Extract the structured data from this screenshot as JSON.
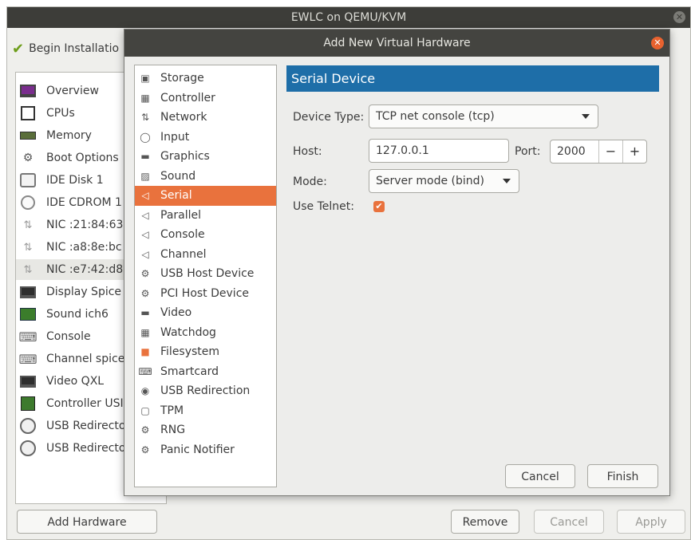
{
  "main_window": {
    "title": "EWLC on QEMU/KVM",
    "begin_install_label": "Begin Installatio",
    "hardware_items": [
      {
        "label": "Overview",
        "icon": "overview-icon"
      },
      {
        "label": "CPUs",
        "icon": "cpu-icon"
      },
      {
        "label": "Memory",
        "icon": "memory-icon"
      },
      {
        "label": "Boot Options",
        "icon": "boot-options-icon"
      },
      {
        "label": "IDE Disk 1",
        "icon": "disk-icon"
      },
      {
        "label": "IDE CDROM 1",
        "icon": "cdrom-icon"
      },
      {
        "label": "NIC :21:84:63",
        "icon": "nic-icon"
      },
      {
        "label": "NIC :a8:8e:bc",
        "icon": "nic-icon"
      },
      {
        "label": "NIC :e7:42:d8",
        "icon": "nic-icon"
      },
      {
        "label": "Display Spice",
        "icon": "display-icon"
      },
      {
        "label": "Sound ich6",
        "icon": "sound-icon"
      },
      {
        "label": "Console",
        "icon": "console-icon"
      },
      {
        "label": "Channel spice",
        "icon": "channel-icon"
      },
      {
        "label": "Video QXL",
        "icon": "video-icon"
      },
      {
        "label": "Controller USI",
        "icon": "controller-icon"
      },
      {
        "label": "USB Redirecto",
        "icon": "usb-redirector-icon"
      },
      {
        "label": "USB Redirecto",
        "icon": "usb-redirector-icon"
      }
    ],
    "selected_hardware_index": 8,
    "add_hardware_label": "Add Hardware",
    "remove_label": "Remove",
    "cancel_label": "Cancel",
    "apply_label": "Apply"
  },
  "dialog": {
    "title": "Add New Virtual Hardware",
    "device_types": [
      {
        "label": "Storage",
        "icon": "storage-icon"
      },
      {
        "label": "Controller",
        "icon": "controller-icon"
      },
      {
        "label": "Network",
        "icon": "network-icon"
      },
      {
        "label": "Input",
        "icon": "mouse-icon"
      },
      {
        "label": "Graphics",
        "icon": "monitor-icon"
      },
      {
        "label": "Sound",
        "icon": "sound-icon"
      },
      {
        "label": "Serial",
        "icon": "serial-icon"
      },
      {
        "label": "Parallel",
        "icon": "parallel-icon"
      },
      {
        "label": "Console",
        "icon": "console-icon"
      },
      {
        "label": "Channel",
        "icon": "channel-icon"
      },
      {
        "label": "USB Host Device",
        "icon": "usb-host-icon"
      },
      {
        "label": "PCI Host Device",
        "icon": "pci-host-icon"
      },
      {
        "label": "Video",
        "icon": "video-icon"
      },
      {
        "label": "Watchdog",
        "icon": "watchdog-icon"
      },
      {
        "label": "Filesystem",
        "icon": "folder-icon"
      },
      {
        "label": "Smartcard",
        "icon": "smartcard-icon"
      },
      {
        "label": "USB Redirection",
        "icon": "usb-redirection-icon"
      },
      {
        "label": "TPM",
        "icon": "tpm-icon"
      },
      {
        "label": "RNG",
        "icon": "rng-icon"
      },
      {
        "label": "Panic Notifier",
        "icon": "panic-notifier-icon"
      }
    ],
    "selected_type_index": 6,
    "section_header": "Serial Device",
    "device_type_label": "Device Type:",
    "device_type_value": "TCP net console (tcp)",
    "host_label": "Host:",
    "host_value": "127.0.0.1",
    "port_label": "Port:",
    "port_value": "2000",
    "port_minus": "−",
    "port_plus": "+",
    "mode_label": "Mode:",
    "mode_value": "Server mode (bind)",
    "use_telnet_label": "Use Telnet:",
    "use_telnet_checked": true,
    "cancel_label": "Cancel",
    "finish_label": "Finish"
  },
  "colors": {
    "selection_orange": "#e9723d",
    "header_blue": "#1e6ea8",
    "titlebar_dark": "#3d3d39",
    "close_orange": "#e8622f"
  }
}
